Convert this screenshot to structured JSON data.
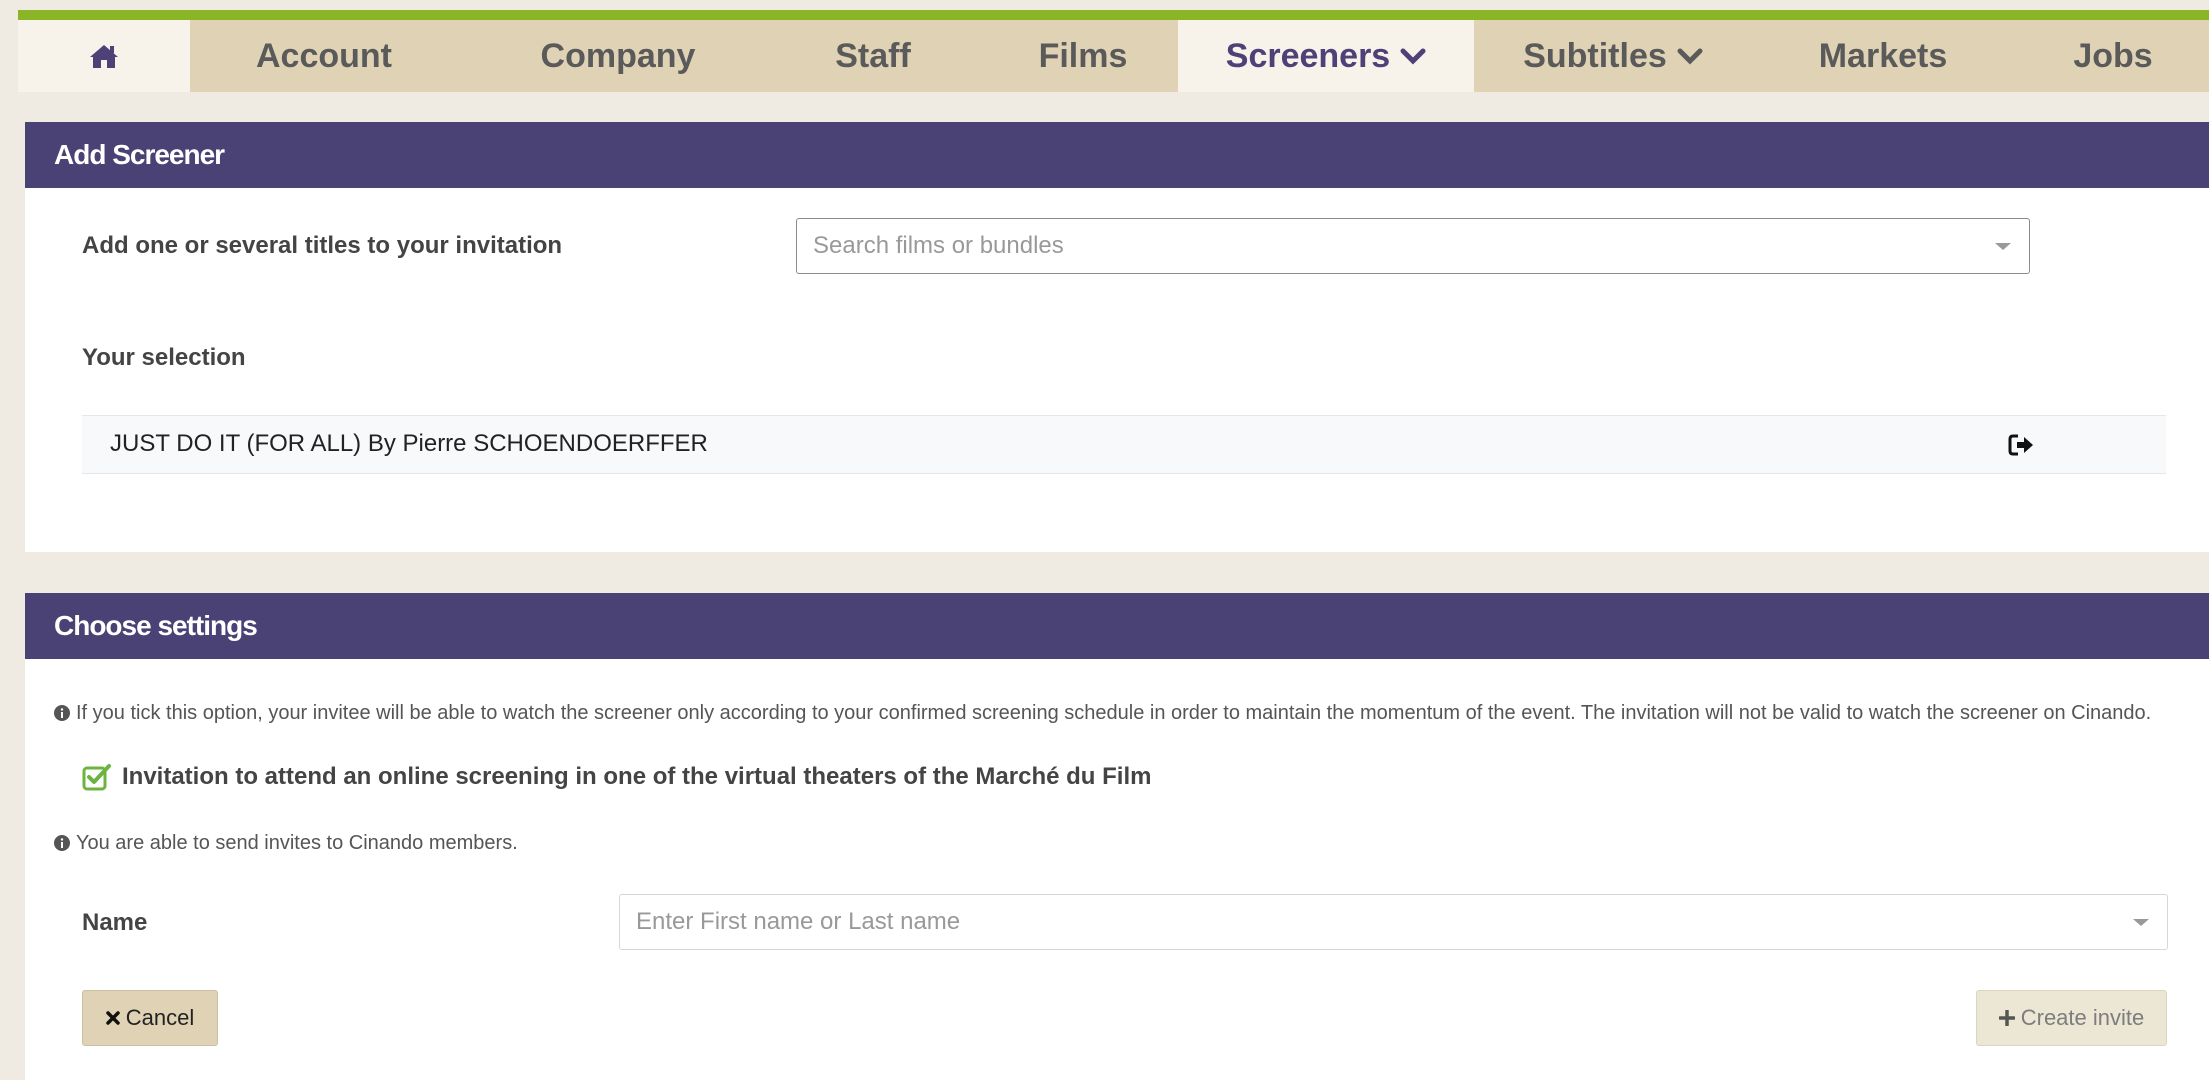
{
  "nav": {
    "home_icon": "home-icon",
    "tabs": [
      {
        "label": "Account"
      },
      {
        "label": "Company"
      },
      {
        "label": "Staff"
      },
      {
        "label": "Films"
      },
      {
        "label": "Screeners",
        "active": true,
        "dropdown": true
      },
      {
        "label": "Subtitles",
        "dropdown": true
      },
      {
        "label": "Markets"
      },
      {
        "label": "Jobs"
      }
    ]
  },
  "add_screener": {
    "title": "Add Screener",
    "titles_label": "Add one or several titles to your invitation",
    "search_placeholder": "Search films or bundles",
    "selection_label": "Your selection",
    "selection": [
      {
        "text": "JUST DO IT (FOR ALL) By Pierre SCHOENDOERFFER",
        "icon": "sign-out-icon"
      }
    ]
  },
  "settings": {
    "title": "Choose settings",
    "info_schedule": "If you tick this option, your invitee will be able to watch the screener only according to your confirmed screening schedule in order to maintain the momentum of the event. The invitation will not be valid to watch the screener on Cinando.",
    "checkbox_label": "Invitation to attend an online screening in one of the virtual theaters of the Marché du Film",
    "checkbox_checked": true,
    "info_members": "You are able to send invites to Cinando members.",
    "name_label": "Name",
    "name_placeholder": "Enter First name or Last name",
    "cancel_label": "Cancel",
    "create_label": "Create invite"
  },
  "colors": {
    "accent_green": "#8ab526",
    "header_purple": "#4a4174",
    "nav_beige": "#e0d3b5",
    "check_green": "#6cb33f"
  }
}
